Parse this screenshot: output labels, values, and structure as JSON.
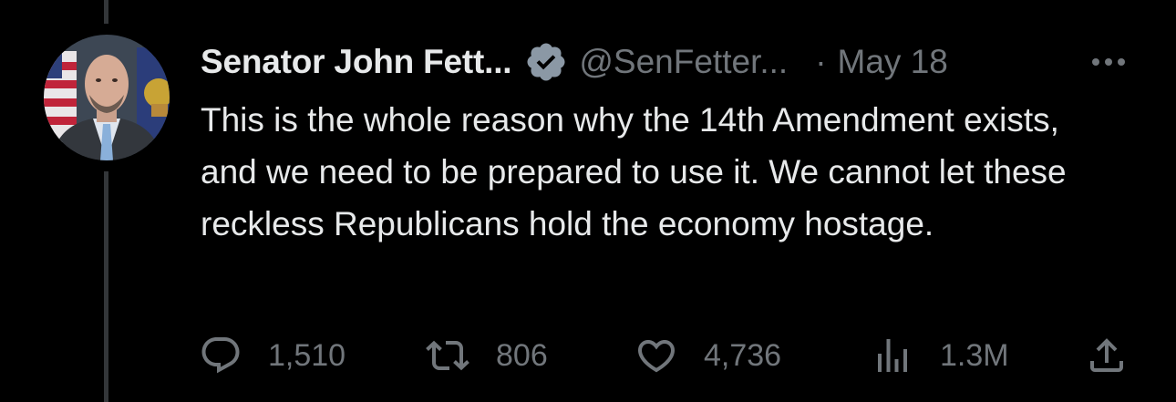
{
  "tweet": {
    "author_name": "Senator John Fett...",
    "handle": "@SenFetter...",
    "separator": "·",
    "date": "May 18",
    "text": "This is the whole reason why the 14th Amendment exists, and we need to be prepared to use it. We cannot let these reckless Republicans hold the economy hostage.",
    "verified": true
  },
  "actions": {
    "replies": "1,510",
    "retweets": "806",
    "likes": "4,736",
    "views": "1.3M"
  },
  "icons": {
    "verified": "verified-badge-icon",
    "more": "more-options-icon",
    "reply": "reply-icon",
    "retweet": "retweet-icon",
    "like": "heart-icon",
    "views": "views-chart-icon",
    "share": "share-icon"
  },
  "colors": {
    "background": "#000000",
    "text_primary": "#e7e9ea",
    "text_secondary": "#71767b",
    "verified_badge": "#8b98a5",
    "thread_line": "#333639"
  }
}
